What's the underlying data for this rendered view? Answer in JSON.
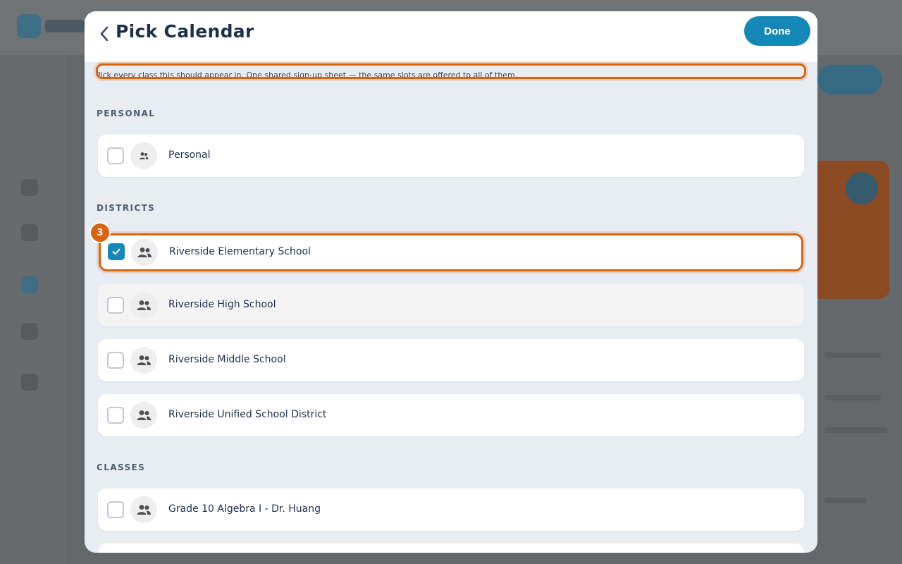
{
  "header": {
    "title": "Pick Calendar",
    "back_icon": "chevron-left-icon",
    "done_label": "Done"
  },
  "hint": "Pick every class this should appear in. One shared sign-up sheet — the same slots are offered to all of them.",
  "sections": {
    "personal": {
      "label": "PERSONAL",
      "items": [
        {
          "label": "Personal",
          "checked": false,
          "icon": "person-icon"
        }
      ]
    },
    "districts": {
      "label": "DISTRICTS",
      "items": [
        {
          "label": "Riverside Elementary School",
          "checked": true,
          "icon": "group-icon"
        },
        {
          "label": "Riverside High School",
          "checked": false,
          "icon": "group-icon"
        },
        {
          "label": "Riverside Middle School",
          "checked": false,
          "icon": "group-icon"
        },
        {
          "label": "Riverside Unified School District",
          "checked": false,
          "icon": "group-icon"
        }
      ]
    },
    "classes": {
      "label": "CLASSES",
      "items": [
        {
          "label": "Grade 10 Algebra I - Dr. Huang",
          "checked": false,
          "icon": "group-icon"
        }
      ]
    }
  },
  "annotation_badge": "3",
  "colors": {
    "accent": "#1688b8",
    "highlight": "#d9640f",
    "modal_bg": "#e8edf4",
    "title": "#1f2f4a"
  }
}
